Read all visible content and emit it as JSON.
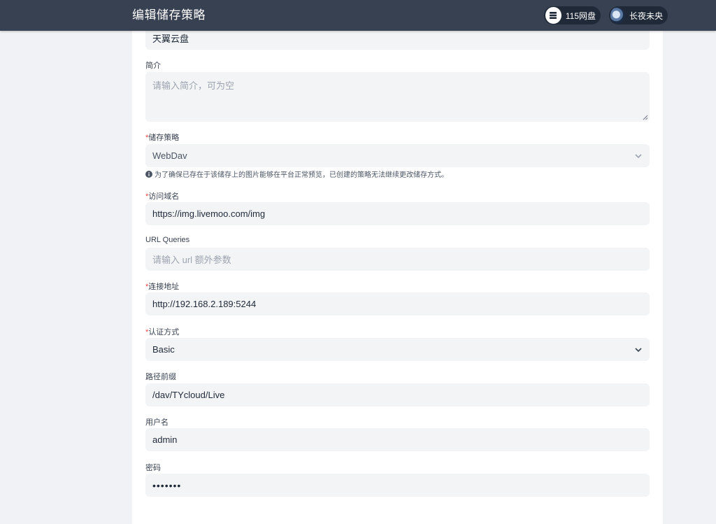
{
  "header": {
    "title": "编辑储存策略",
    "storage_pill": {
      "icon": "server-icon",
      "label": "115网盘"
    },
    "user_pill": {
      "icon": "avatar",
      "label": "长夜未央"
    }
  },
  "form": {
    "name": {
      "value": "天翼云盘"
    },
    "intro": {
      "label": "简介",
      "placeholder": "请输入简介，可为空"
    },
    "strategy": {
      "required": "*",
      "label": "储存策略",
      "value": "WebDav",
      "hint": "为了确保已存在于该储存上的图片能够在平台正常预览，已创建的策略无法继续更改储存方式。"
    },
    "domain": {
      "required": "*",
      "label": "访问域名",
      "value": "https://img.livemoo.com/img"
    },
    "url_queries": {
      "label": "URL Queries",
      "placeholder": "请输入 url 额外参数"
    },
    "endpoint": {
      "required": "*",
      "label": "连接地址",
      "value": "http://192.168.2.189:5244"
    },
    "auth": {
      "required": "*",
      "label": "认证方式",
      "value": "Basic"
    },
    "prefix": {
      "label": "路径前缀",
      "value": "/dav/TYcloud/Live"
    },
    "username": {
      "label": "用户名",
      "value": "admin"
    },
    "password": {
      "label": "密码",
      "value": "•••••••"
    }
  }
}
